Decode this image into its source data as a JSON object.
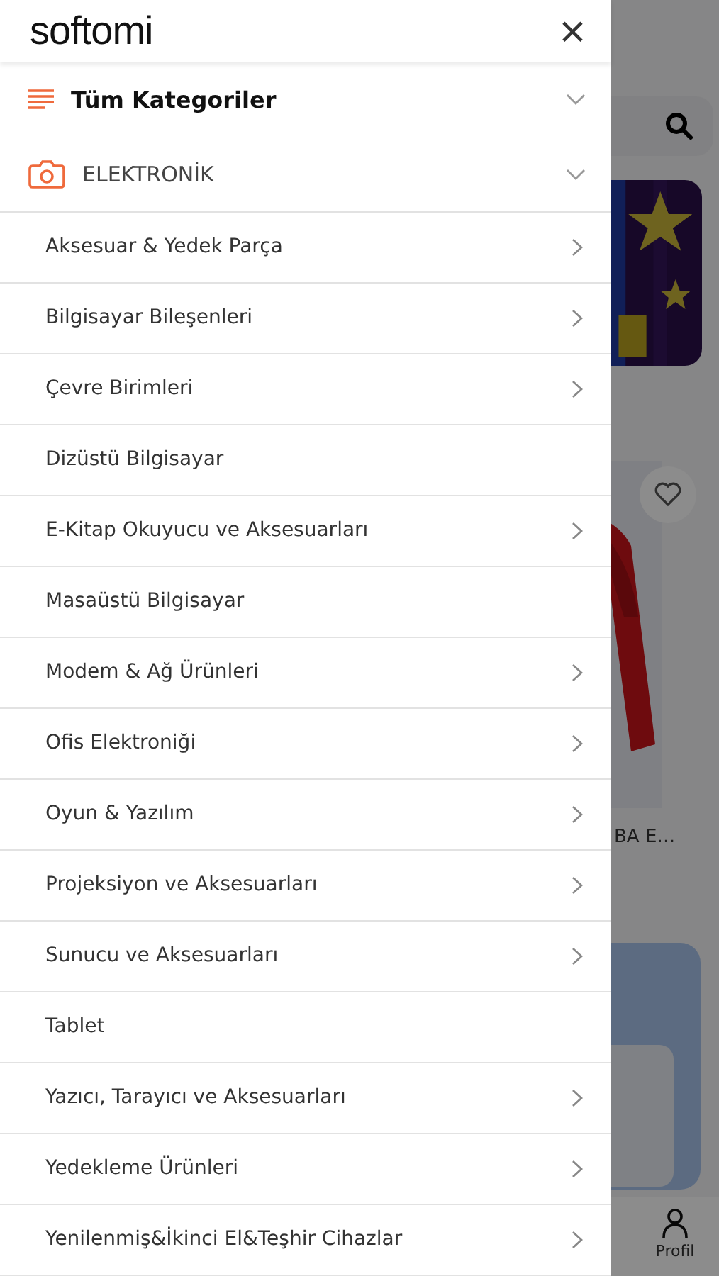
{
  "drawer": {
    "logo": "softomi",
    "close": "×",
    "sections": [
      {
        "kind": "menu",
        "title": "Tüm Kategoriler"
      },
      {
        "kind": "camera",
        "title": "ELEKTRONİK"
      }
    ],
    "items": [
      {
        "label": "Aksesuar & Yedek Parça",
        "has_children": true
      },
      {
        "label": "Bilgisayar Bileşenleri",
        "has_children": true
      },
      {
        "label": "Çevre Birimleri",
        "has_children": true
      },
      {
        "label": "Dizüstü Bilgisayar",
        "has_children": false
      },
      {
        "label": "E-Kitap Okuyucu ve Aksesuarları",
        "has_children": true
      },
      {
        "label": "Masaüstü Bilgisayar",
        "has_children": false
      },
      {
        "label": "Modem & Ağ Ürünleri",
        "has_children": true
      },
      {
        "label": "Ofis Elektroniği",
        "has_children": true
      },
      {
        "label": "Oyun & Yazılım",
        "has_children": true
      },
      {
        "label": "Projeksiyon ve Aksesuarları",
        "has_children": true
      },
      {
        "label": "Sunucu ve Aksesuarları",
        "has_children": true
      },
      {
        "label": "Tablet",
        "has_children": false
      },
      {
        "label": "Yazıcı, Tarayıcı ve Aksesuarları",
        "has_children": true
      },
      {
        "label": "Yedekleme Ürünleri",
        "has_children": true
      },
      {
        "label": "Yenilenmiş&İkinci El&Teşhir Cihazlar",
        "has_children": true
      }
    ]
  },
  "background": {
    "product": {
      "name": "BA E…"
    },
    "nav": [
      {
        "label": "Profil"
      }
    ]
  }
}
